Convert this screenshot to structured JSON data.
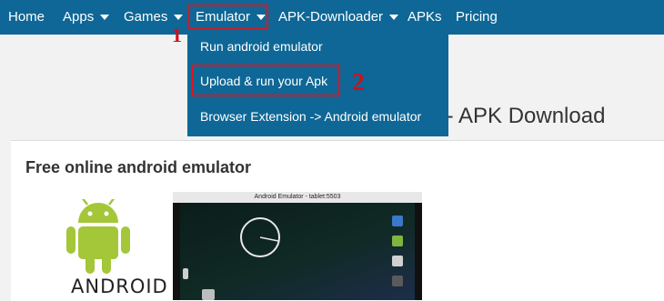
{
  "navbar": {
    "items": [
      "Home",
      "Apps",
      "Games",
      "Emulator",
      "APK-Downloader",
      "APKs",
      "Pricing"
    ]
  },
  "dropdown": {
    "items": [
      "Run android emulator",
      "Upload & run your Apk",
      "Browser Extension -> Android emulator"
    ]
  },
  "markers": {
    "one": "1",
    "two": "2"
  },
  "page": {
    "heading_partial": "r - APK Download",
    "card_title": "Free online android emulator",
    "android_word": "ANDROID"
  },
  "emulator": {
    "title": "Android Emulator - tablet:5503"
  },
  "colors": {
    "nav_bg": "#0e6796",
    "highlight": "#e0141e",
    "android_green": "#a4c639"
  },
  "icons": [
    "caret-down-icon",
    "android-robot-icon",
    "clock-widget-icon"
  ]
}
